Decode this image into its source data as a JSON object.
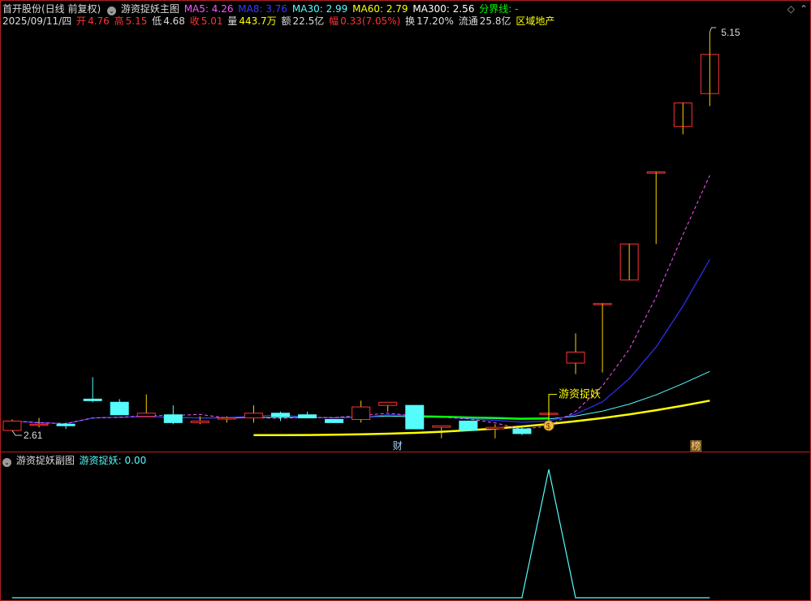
{
  "main_header": {
    "stock": "首开股份(日线 前复权)",
    "indicator_name": "游资捉妖主图",
    "ma5": "MA5: 4.26",
    "ma8": "MA8: 3.76",
    "ma30": "MA30: 2.99",
    "ma60": "MA60: 2.79",
    "ma300": "MA300: 2.56",
    "fenjie": "分界线: -"
  },
  "info_row": {
    "date": "2025/09/11/四",
    "open_label": "开",
    "open": "4.76",
    "high_label": "高",
    "high": "5.15",
    "low_label": "低",
    "low": "4.68",
    "close_label": "收",
    "close": "5.01",
    "vol_label": "量",
    "vol": "443.7万",
    "amt_label": "额",
    "amt": "22.5亿",
    "chg_label": "幅",
    "chg": "0.33(7.05%)",
    "turn_label": "换",
    "turn": "17.20%",
    "float_label": "流通",
    "float": "25.8亿",
    "sector": "区域地产"
  },
  "annotations": {
    "high_label": "5.15",
    "low_label": "2.61",
    "signal_text": "游资捉妖",
    "marker_cai": "财",
    "marker_bang": "榜",
    "dollar": "$"
  },
  "sub_header": {
    "indicator_name": "游资捉妖副图",
    "value": "游资捉妖: 0.00"
  },
  "colors": {
    "up": "#ff3232",
    "down": "#54fcfc",
    "ma5": "#ff54ff",
    "ma8": "#3030ff",
    "ma30": "#54fcfc",
    "ma60": "#ffff00",
    "ma300": "#ffffff",
    "fenjie": "#00ff00",
    "border": "#b02020"
  },
  "chart_data": {
    "type": "candlestick",
    "price_range": [
      2.61,
      5.15
    ],
    "candles": [
      {
        "o": 2.61,
        "h": 2.68,
        "l": 2.61,
        "c": 2.67
      },
      {
        "o": 2.65,
        "h": 2.69,
        "l": 2.63,
        "c": 2.65
      },
      {
        "o": 2.65,
        "h": 2.66,
        "l": 2.62,
        "c": 2.64
      },
      {
        "o": 2.81,
        "h": 2.95,
        "l": 2.79,
        "c": 2.8
      },
      {
        "o": 2.79,
        "h": 2.81,
        "l": 2.71,
        "c": 2.71
      },
      {
        "o": 2.7,
        "h": 2.84,
        "l": 2.7,
        "c": 2.72
      },
      {
        "o": 2.71,
        "h": 2.77,
        "l": 2.65,
        "c": 2.66
      },
      {
        "o": 2.66,
        "h": 2.7,
        "l": 2.65,
        "c": 2.67
      },
      {
        "o": 2.69,
        "h": 2.7,
        "l": 2.66,
        "c": 2.69
      },
      {
        "o": 2.69,
        "h": 2.77,
        "l": 2.66,
        "c": 2.72
      },
      {
        "o": 2.72,
        "h": 2.73,
        "l": 2.67,
        "c": 2.7
      },
      {
        "o": 2.71,
        "h": 2.73,
        "l": 2.69,
        "c": 2.69
      },
      {
        "o": 2.68,
        "h": 2.68,
        "l": 2.66,
        "c": 2.66
      },
      {
        "o": 2.68,
        "h": 2.8,
        "l": 2.66,
        "c": 2.76
      },
      {
        "o": 2.77,
        "h": 2.79,
        "l": 2.73,
        "c": 2.79
      },
      {
        "o": 2.77,
        "h": 2.77,
        "l": 2.62,
        "c": 2.62
      },
      {
        "o": 2.63,
        "h": 2.64,
        "l": 2.56,
        "c": 2.64
      },
      {
        "o": 2.67,
        "h": 2.67,
        "l": 2.61,
        "c": 2.61
      },
      {
        "o": 2.62,
        "h": 2.65,
        "l": 2.56,
        "c": 2.63
      },
      {
        "o": 2.62,
        "h": 2.63,
        "l": 2.58,
        "c": 2.59
      },
      {
        "o": 2.72,
        "h": 2.78,
        "l": 2.68,
        "c": 2.72
      },
      {
        "o": 3.04,
        "h": 3.23,
        "l": 2.97,
        "c": 3.11
      },
      {
        "o": 3.42,
        "h": 3.42,
        "l": 2.98,
        "c": 3.42
      },
      {
        "o": 3.57,
        "h": 3.73,
        "l": 3.57,
        "c": 3.8
      },
      {
        "o": 4.26,
        "h": 4.26,
        "l": 3.8,
        "c": 4.26
      },
      {
        "o": 4.55,
        "h": 4.65,
        "l": 4.5,
        "c": 4.7
      },
      {
        "o": 4.76,
        "h": 5.15,
        "l": 4.68,
        "c": 5.01
      }
    ],
    "indicator": {
      "name": "游资捉妖",
      "values": [
        0,
        0,
        0,
        0,
        0,
        0,
        0,
        0,
        0,
        0,
        0,
        0,
        0,
        0,
        0,
        0,
        0,
        0,
        0,
        0,
        1,
        0,
        0,
        0,
        0,
        0,
        0
      ],
      "ylim": [
        0,
        1
      ]
    }
  }
}
